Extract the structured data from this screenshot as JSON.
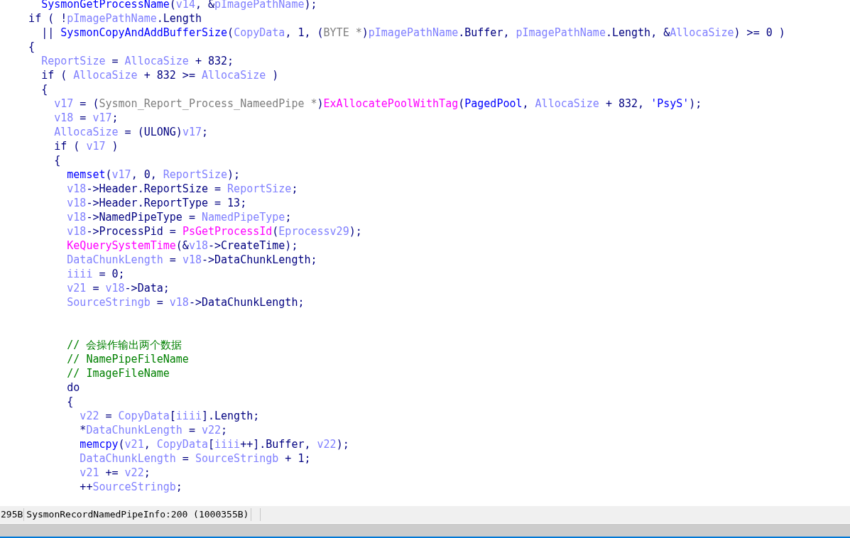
{
  "code_lines": [
    {
      "kind": "code",
      "tokens": [
        {
          "kind": "func",
          "text": "      SysmonGetProcessName"
        },
        {
          "kind": "plain",
          "text": "("
        },
        {
          "kind": "var",
          "text": "v14"
        },
        {
          "kind": "plain",
          "text": ", &"
        },
        {
          "kind": "var",
          "text": "pImagePathName"
        },
        {
          "kind": "plain",
          "text": ");"
        }
      ]
    },
    {
      "kind": "code",
      "tokens": [
        {
          "kind": "plain",
          "text": "    if ( !"
        },
        {
          "kind": "var",
          "text": "pImagePathName"
        },
        {
          "kind": "plain",
          "text": ".Length"
        }
      ]
    },
    {
      "kind": "code",
      "tokens": [
        {
          "kind": "plain",
          "text": "      || "
        },
        {
          "kind": "func",
          "text": "SysmonCopyAndAddBufferSize"
        },
        {
          "kind": "plain",
          "text": "("
        },
        {
          "kind": "var",
          "text": "CopyData"
        },
        {
          "kind": "plain",
          "text": ", 1, ("
        },
        {
          "kind": "type",
          "text": "BYTE *"
        },
        {
          "kind": "plain",
          "text": ")"
        },
        {
          "kind": "var",
          "text": "pImagePathName"
        },
        {
          "kind": "plain",
          "text": ".Buffer, "
        },
        {
          "kind": "var",
          "text": "pImagePathName"
        },
        {
          "kind": "plain",
          "text": ".Length, &"
        },
        {
          "kind": "var",
          "text": "AllocaSize"
        },
        {
          "kind": "plain",
          "text": ") >= 0 )"
        }
      ]
    },
    {
      "kind": "code",
      "tokens": [
        {
          "kind": "plain",
          "text": "    {"
        }
      ]
    },
    {
      "kind": "code",
      "tokens": [
        {
          "kind": "var",
          "text": "      ReportSize"
        },
        {
          "kind": "plain",
          "text": " = "
        },
        {
          "kind": "var",
          "text": "AllocaSize"
        },
        {
          "kind": "plain",
          "text": " + 832;"
        }
      ]
    },
    {
      "kind": "code",
      "tokens": [
        {
          "kind": "plain",
          "text": "      if ( "
        },
        {
          "kind": "var",
          "text": "AllocaSize"
        },
        {
          "kind": "plain",
          "text": " + 832 >= "
        },
        {
          "kind": "var",
          "text": "AllocaSize"
        },
        {
          "kind": "plain",
          "text": " )"
        }
      ]
    },
    {
      "kind": "code",
      "tokens": [
        {
          "kind": "plain",
          "text": "      {"
        }
      ]
    },
    {
      "kind": "code",
      "tokens": [
        {
          "kind": "var",
          "text": "        v17"
        },
        {
          "kind": "plain",
          "text": " = ("
        },
        {
          "kind": "type",
          "text": "Sysmon_Report_Process_NameedPipe *"
        },
        {
          "kind": "plain",
          "text": ")"
        },
        {
          "kind": "import",
          "text": "ExAllocatePoolWithTag"
        },
        {
          "kind": "plain",
          "text": "("
        },
        {
          "kind": "func",
          "text": "PagedPool"
        },
        {
          "kind": "plain",
          "text": ", "
        },
        {
          "kind": "var",
          "text": "AllocaSize"
        },
        {
          "kind": "plain",
          "text": " + 832, "
        },
        {
          "kind": "string",
          "text": "'PsyS'"
        },
        {
          "kind": "plain",
          "text": ");"
        }
      ]
    },
    {
      "kind": "code",
      "tokens": [
        {
          "kind": "var",
          "text": "        v18"
        },
        {
          "kind": "plain",
          "text": " = "
        },
        {
          "kind": "var",
          "text": "v17"
        },
        {
          "kind": "plain",
          "text": ";"
        }
      ]
    },
    {
      "kind": "code",
      "tokens": [
        {
          "kind": "var",
          "text": "        AllocaSize"
        },
        {
          "kind": "plain",
          "text": " = (ULONG)"
        },
        {
          "kind": "var",
          "text": "v17"
        },
        {
          "kind": "plain",
          "text": ";"
        }
      ]
    },
    {
      "kind": "code",
      "tokens": [
        {
          "kind": "plain",
          "text": "        if ( "
        },
        {
          "kind": "var",
          "text": "v17"
        },
        {
          "kind": "plain",
          "text": " )"
        }
      ]
    },
    {
      "kind": "code",
      "tokens": [
        {
          "kind": "plain",
          "text": "        {"
        }
      ]
    },
    {
      "kind": "code",
      "tokens": [
        {
          "kind": "func",
          "text": "          memset"
        },
        {
          "kind": "plain",
          "text": "("
        },
        {
          "kind": "var",
          "text": "v17"
        },
        {
          "kind": "plain",
          "text": ", 0, "
        },
        {
          "kind": "var",
          "text": "ReportSize"
        },
        {
          "kind": "plain",
          "text": ");"
        }
      ]
    },
    {
      "kind": "code",
      "tokens": [
        {
          "kind": "var",
          "text": "          v18"
        },
        {
          "kind": "plain",
          "text": "->Header.ReportSize = "
        },
        {
          "kind": "var",
          "text": "ReportSize"
        },
        {
          "kind": "plain",
          "text": ";"
        }
      ]
    },
    {
      "kind": "code",
      "tokens": [
        {
          "kind": "var",
          "text": "          v18"
        },
        {
          "kind": "plain",
          "text": "->Header.ReportType = 13;"
        }
      ]
    },
    {
      "kind": "code",
      "tokens": [
        {
          "kind": "var",
          "text": "          v18"
        },
        {
          "kind": "plain",
          "text": "->NamedPipeType = "
        },
        {
          "kind": "var",
          "text": "NamedPipeType"
        },
        {
          "kind": "plain",
          "text": ";"
        }
      ]
    },
    {
      "kind": "code",
      "tokens": [
        {
          "kind": "var",
          "text": "          v18"
        },
        {
          "kind": "plain",
          "text": "->ProcessPid = "
        },
        {
          "kind": "import",
          "text": "PsGetProcessId"
        },
        {
          "kind": "plain",
          "text": "("
        },
        {
          "kind": "var",
          "text": "Eprocessv29"
        },
        {
          "kind": "plain",
          "text": ");"
        }
      ]
    },
    {
      "kind": "code",
      "tokens": [
        {
          "kind": "import",
          "text": "          KeQuerySystemTime"
        },
        {
          "kind": "plain",
          "text": "(&"
        },
        {
          "kind": "var",
          "text": "v18"
        },
        {
          "kind": "plain",
          "text": "->CreateTime);"
        }
      ]
    },
    {
      "kind": "code",
      "tokens": [
        {
          "kind": "var",
          "text": "          DataChunkLength"
        },
        {
          "kind": "plain",
          "text": " = "
        },
        {
          "kind": "var",
          "text": "v18"
        },
        {
          "kind": "plain",
          "text": "->DataChunkLength;"
        }
      ]
    },
    {
      "kind": "code",
      "tokens": [
        {
          "kind": "var",
          "text": "          iiii"
        },
        {
          "kind": "plain",
          "text": " = 0;"
        }
      ]
    },
    {
      "kind": "code",
      "tokens": [
        {
          "kind": "var",
          "text": "          v21"
        },
        {
          "kind": "plain",
          "text": " = "
        },
        {
          "kind": "var",
          "text": "v18"
        },
        {
          "kind": "plain",
          "text": "->Data;"
        }
      ]
    },
    {
      "kind": "code",
      "tokens": [
        {
          "kind": "var",
          "text": "          SourceStringb"
        },
        {
          "kind": "plain",
          "text": " = "
        },
        {
          "kind": "var",
          "text": "v18"
        },
        {
          "kind": "plain",
          "text": "->DataChunkLength;"
        }
      ]
    },
    {
      "kind": "blank"
    },
    {
      "kind": "blank"
    },
    {
      "kind": "code",
      "tokens": [
        {
          "kind": "comment",
          "text": "          // 会操作输出两个数据"
        }
      ]
    },
    {
      "kind": "code",
      "tokens": [
        {
          "kind": "comment",
          "text": "          // NamePipeFileName"
        }
      ]
    },
    {
      "kind": "code",
      "tokens": [
        {
          "kind": "comment",
          "text": "          // ImageFileName"
        }
      ]
    },
    {
      "kind": "code",
      "tokens": [
        {
          "kind": "plain",
          "text": "          do"
        }
      ]
    },
    {
      "kind": "code",
      "tokens": [
        {
          "kind": "plain",
          "text": "          {"
        }
      ]
    },
    {
      "kind": "code",
      "tokens": [
        {
          "kind": "var",
          "text": "            v22"
        },
        {
          "kind": "plain",
          "text": " = "
        },
        {
          "kind": "var",
          "text": "CopyData"
        },
        {
          "kind": "plain",
          "text": "["
        },
        {
          "kind": "var",
          "text": "iiii"
        },
        {
          "kind": "plain",
          "text": "].Length;"
        }
      ]
    },
    {
      "kind": "code",
      "tokens": [
        {
          "kind": "plain",
          "text": "            *"
        },
        {
          "kind": "var",
          "text": "DataChunkLength"
        },
        {
          "kind": "plain",
          "text": " = "
        },
        {
          "kind": "var",
          "text": "v22"
        },
        {
          "kind": "plain",
          "text": ";"
        }
      ]
    },
    {
      "kind": "code",
      "tokens": [
        {
          "kind": "func",
          "text": "            memcpy"
        },
        {
          "kind": "plain",
          "text": "("
        },
        {
          "kind": "var",
          "text": "v21"
        },
        {
          "kind": "plain",
          "text": ", "
        },
        {
          "kind": "var",
          "text": "CopyData"
        },
        {
          "kind": "plain",
          "text": "["
        },
        {
          "kind": "var",
          "text": "iiii"
        },
        {
          "kind": "plain",
          "text": "++].Buffer, "
        },
        {
          "kind": "var",
          "text": "v22"
        },
        {
          "kind": "plain",
          "text": ");"
        }
      ]
    },
    {
      "kind": "code",
      "tokens": [
        {
          "kind": "var",
          "text": "            DataChunkLength"
        },
        {
          "kind": "plain",
          "text": " = "
        },
        {
          "kind": "var",
          "text": "SourceStringb"
        },
        {
          "kind": "plain",
          "text": " + 1;"
        }
      ]
    },
    {
      "kind": "code",
      "tokens": [
        {
          "kind": "var",
          "text": "            v21"
        },
        {
          "kind": "plain",
          "text": " += "
        },
        {
          "kind": "var",
          "text": "v22"
        },
        {
          "kind": "plain",
          "text": ";"
        }
      ]
    },
    {
      "kind": "code",
      "tokens": [
        {
          "kind": "plain",
          "text": "            ++"
        },
        {
          "kind": "var",
          "text": "SourceStringb"
        },
        {
          "kind": "plain",
          "text": ";"
        }
      ]
    }
  ],
  "status_bar": {
    "offset": "295B",
    "location": "SysmonRecordNamedPipeInfo:200 (1000355B)"
  }
}
